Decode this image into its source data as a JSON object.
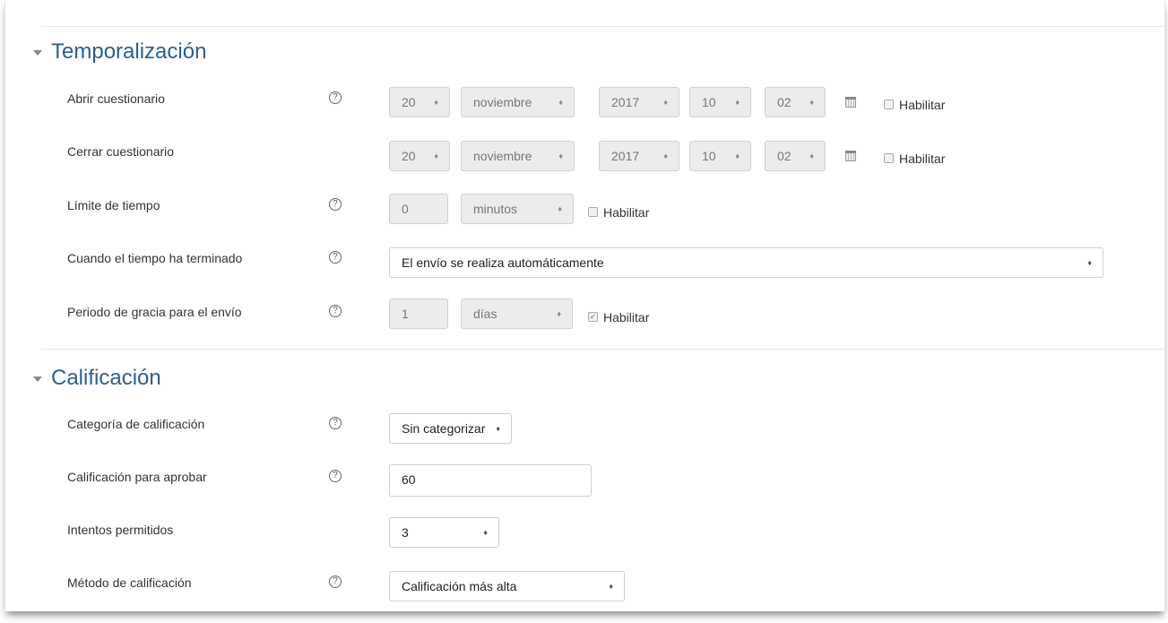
{
  "sections": {
    "timing": {
      "title": "Temporalización"
    },
    "grade": {
      "title": "Calificación"
    }
  },
  "help_glyph": "?",
  "calendar_icon": "calendar-icon",
  "open_quiz": {
    "label": "Abrir cuestionario",
    "day": "20",
    "month": "noviembre",
    "year": "2017",
    "hour": "10",
    "minute": "02",
    "enable_label": "Habilitar",
    "enabled": false
  },
  "close_quiz": {
    "label": "Cerrar cuestionario",
    "day": "20",
    "month": "noviembre",
    "year": "2017",
    "hour": "10",
    "minute": "02",
    "enable_label": "Habilitar",
    "enabled": false
  },
  "time_limit": {
    "label": "Límite de tiempo",
    "value": "0",
    "unit": "minutos",
    "enable_label": "Habilitar",
    "enabled": false
  },
  "overdue": {
    "label": "Cuando el tiempo ha terminado",
    "value": "El envío se realiza automáticamente"
  },
  "grace_period": {
    "label": "Periodo de gracia para el envío",
    "value": "1",
    "unit": "días",
    "enable_label": "Habilitar",
    "enabled": true,
    "check_glyph": "✓"
  },
  "grade_category": {
    "label": "Categoría de calificación",
    "value": "Sin categorizar"
  },
  "grade_pass": {
    "label": "Calificación para aprobar",
    "value": "60"
  },
  "attempts": {
    "label": "Intentos permitidos",
    "value": "3"
  },
  "grade_method": {
    "label": "Método de calificación",
    "value": "Calificación más alta"
  },
  "colors": {
    "section_title": "#2d5f8f",
    "disabled_bg": "#ececec",
    "border": "#d0d0d0"
  }
}
